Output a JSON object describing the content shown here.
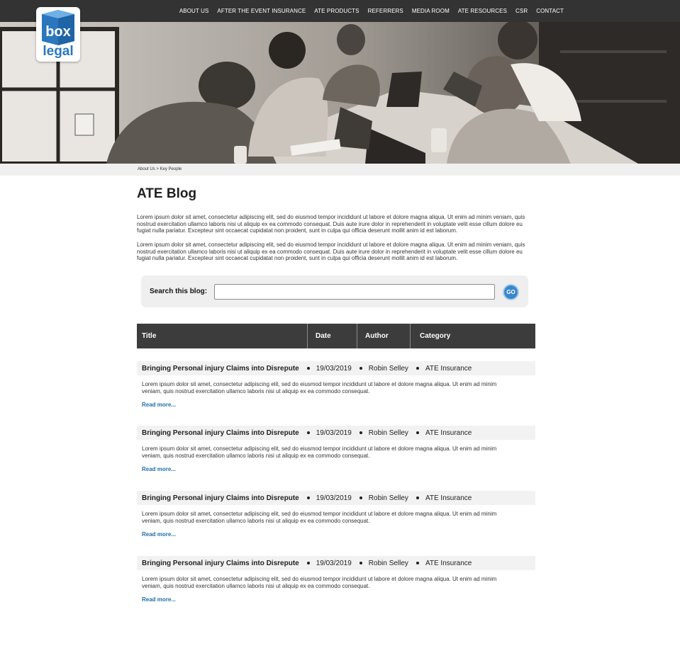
{
  "colors": {
    "nav_bg": "#333333",
    "accent": "#3a87c8",
    "link": "#1f6fa8",
    "table_header": "#3c3c3c",
    "logo_blue": "#2a77bd"
  },
  "logo": {
    "line1": "box",
    "line2": "legal"
  },
  "nav": {
    "items": [
      "ABOUT US",
      "AFTER THE EVENT INSURANCE",
      "ATE PRODUCTS",
      "REFERRERS",
      "MEDIA ROOM",
      "ATE RESOURCES",
      "CSR",
      "CONTACT"
    ]
  },
  "breadcrumb": "About Us > Key People",
  "page": {
    "title": "ATE Blog",
    "intro": [
      "Lorem ipsum dolor sit amet, consectetur adipiscing elit, sed do eiusmod tempor incididunt ut labore et dolore magna aliqua. Ut enim ad minim veniam, quis nostrud exercitation ullamco laboris nisi ut aliquip ex ea commodo consequat. Duis aute irure dolor in reprehenderit in voluptate velit esse cillum dolore eu fugiat nulla pariatur. Excepteur sint occaecat cupidatat non proident, sunt in culpa qui officia deserunt mollit anim id est laborum.",
      "Lorem ipsum dolor sit amet, consectetur adipiscing elit, sed do eiusmod tempor incididunt ut labore et dolore magna aliqua. Ut enim ad minim veniam, quis nostrud exercitation ullamco laboris nisi ut aliquip ex ea commodo consequat. Duis aute irure dolor in reprehenderit in voluptate velit esse cillum dolore eu fugiat nulla pariatur. Excepteur sint occaecat cupidatat non proident, sunt in culpa qui officia deserunt mollit anim id est laborum."
    ]
  },
  "search": {
    "label": "Search this blog:",
    "value": "",
    "placeholder": "",
    "button": "GO"
  },
  "table": {
    "headers": {
      "title": "Title",
      "date": "Date",
      "author": "Author",
      "category": "Category"
    }
  },
  "posts": [
    {
      "title": "Bringing Personal injury Claims into Disrepute",
      "date": "19/03/2019",
      "author": "Robin Selley",
      "category": "ATE Insurance",
      "excerpt": "Lorem ipsum dolor sit amet, consectetur adipiscing elit, sed do eiusmod tempor incididunt ut labore et dolore magna aliqua. Ut enim ad minim veniam, quis nostrud exercitation ullamco laboris nisi ut aliquip ex ea commodo consequat.",
      "read_more": "Read more..."
    },
    {
      "title": "Bringing Personal injury Claims into Disrepute",
      "date": "19/03/2019",
      "author": "Robin Selley",
      "category": "ATE Insurance",
      "excerpt": "Lorem ipsum dolor sit amet, consectetur adipiscing elit, sed do eiusmod tempor incididunt ut labore et dolore magna aliqua. Ut enim ad minim veniam, quis nostrud exercitation ullamco laboris nisi ut aliquip ex ea commodo consequat.",
      "read_more": "Read more..."
    },
    {
      "title": "Bringing Personal injury Claims into Disrepute",
      "date": "19/03/2019",
      "author": "Robin Selley",
      "category": "ATE Insurance",
      "excerpt": "Lorem ipsum dolor sit amet, consectetur adipiscing elit, sed do eiusmod tempor incididunt ut labore et dolore magna aliqua. Ut enim ad minim veniam, quis nostrud exercitation ullamco laboris nisi ut aliquip ex ea commodo consequat.",
      "read_more": "Read more..."
    },
    {
      "title": "Bringing Personal injury Claims into Disrepute",
      "date": "19/03/2019",
      "author": "Robin Selley",
      "category": "ATE Insurance",
      "excerpt": "Lorem ipsum dolor sit amet, consectetur adipiscing elit, sed do eiusmod tempor incididunt ut labore et dolore magna aliqua. Ut enim ad minim veniam, quis nostrud exercitation ullamco laboris nisi ut aliquip ex ea commodo consequat.",
      "read_more": "Read more..."
    }
  ]
}
